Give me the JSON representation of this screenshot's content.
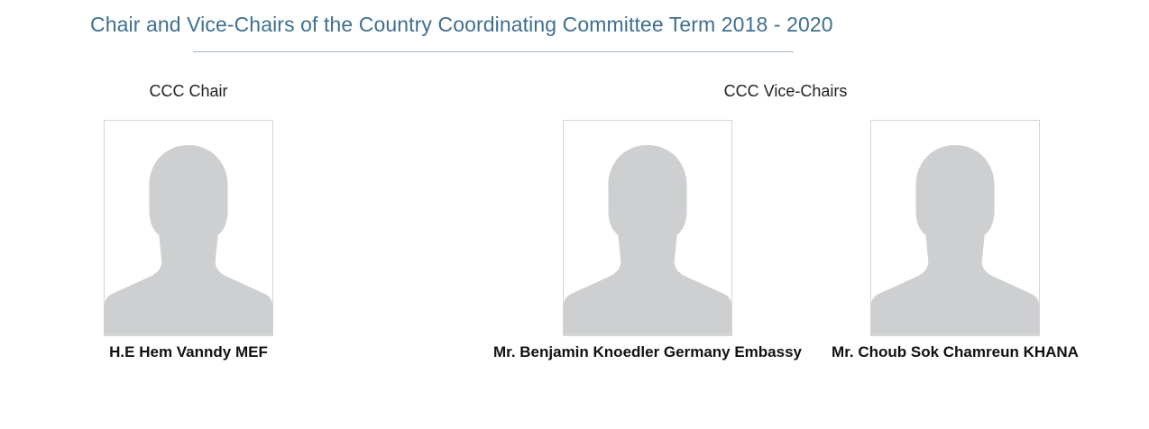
{
  "page": {
    "title": "Chair and Vice-Chairs of the Country Coordinating Committee Term 2018 - 2020"
  },
  "sections": {
    "chair_label": "CCC Chair",
    "vice_chairs_label": "CCC Vice-Chairs"
  },
  "members": [
    {
      "name": "H.E Hem Vanndy MEF",
      "photo_icon": "person-silhouette-icon"
    },
    {
      "name": "Mr. Benjamin Knoedler Germany Embassy",
      "photo_icon": "person-silhouette-icon"
    },
    {
      "name": "Mr. Choub Sok Chamreun KHANA",
      "photo_icon": "person-silhouette-icon"
    }
  ],
  "colors": {
    "title": "#3f6f8f",
    "silhouette": "#cdcfd1",
    "photo_border": "#d4d4d4"
  }
}
